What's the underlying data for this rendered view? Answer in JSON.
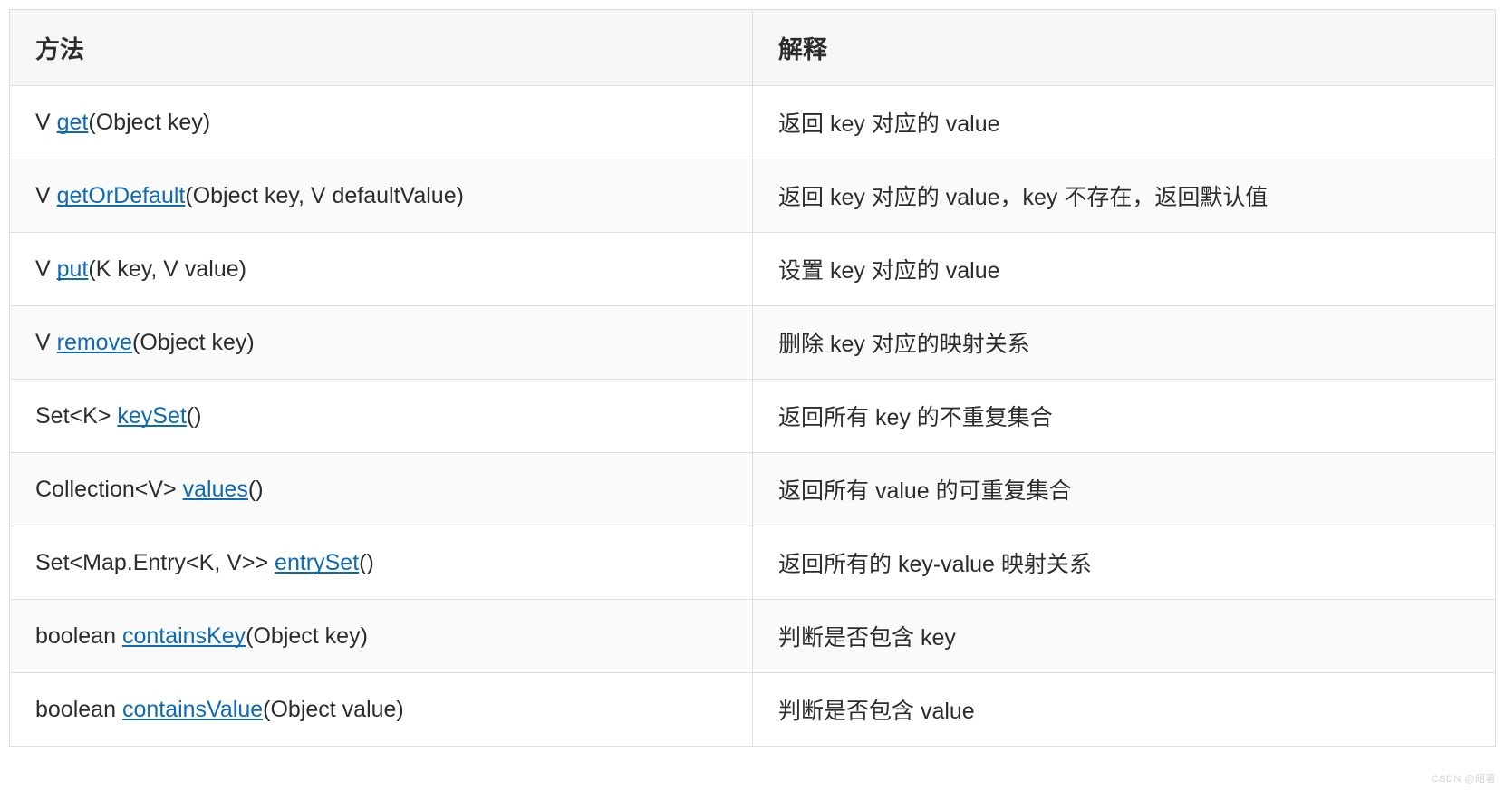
{
  "table": {
    "headers": {
      "method": "方法",
      "desc": "解释"
    },
    "rows": [
      {
        "method": {
          "pre": "V ",
          "link": "get",
          "post": "(Object key)"
        },
        "desc": "返回 key 对应的 value"
      },
      {
        "method": {
          "pre": "V ",
          "link": "getOrDefault",
          "post": "(Object key, V defaultValue)"
        },
        "desc": "返回 key 对应的 value，key 不存在，返回默认值"
      },
      {
        "method": {
          "pre": "V ",
          "link": "put",
          "post": "(K key, V value)"
        },
        "desc": "设置 key 对应的 value"
      },
      {
        "method": {
          "pre": "V ",
          "link": "remove",
          "post": "(Object key)"
        },
        "desc": "删除 key 对应的映射关系"
      },
      {
        "method": {
          "pre": "Set<K> ",
          "link": "keySet",
          "post": "()"
        },
        "desc": "返回所有 key 的不重复集合"
      },
      {
        "method": {
          "pre": "Collection<V> ",
          "link": "values",
          "post": "()"
        },
        "desc": "返回所有 value 的可重复集合"
      },
      {
        "method": {
          "pre": "Set<Map.Entry<K, V>> ",
          "link": "entrySet",
          "post": "()"
        },
        "desc": "返回所有的 key-value 映射关系"
      },
      {
        "method": {
          "pre": "boolean ",
          "link": "containsKey",
          "post": "(Object key)"
        },
        "desc": "判断是否包含 key"
      },
      {
        "method": {
          "pre": "boolean ",
          "link": "containsValue",
          "post": "(Object value)"
        },
        "desc": "判断是否包含 value"
      }
    ]
  },
  "watermark": "CSDN @昭著"
}
